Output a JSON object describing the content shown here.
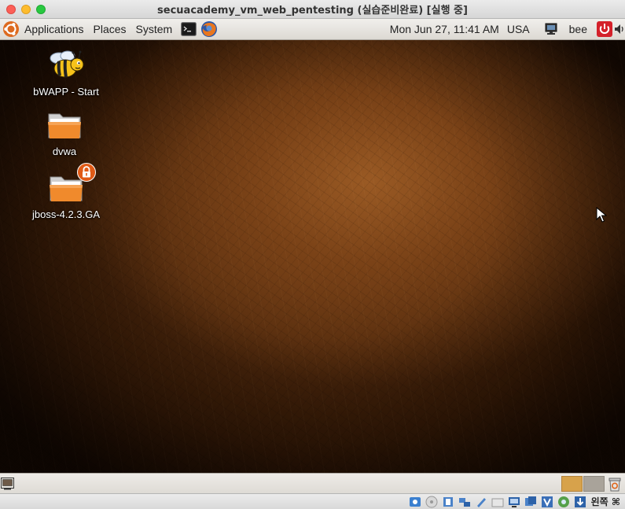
{
  "window": {
    "title": "secuacademy_vm_web_pentesting (실습준비완료) [실행 중]"
  },
  "top_panel": {
    "menus": [
      "Applications",
      "Places",
      "System"
    ],
    "clock": "Mon Jun 27, 11:41 AM",
    "keyboard_layout": "USA",
    "user": "bee",
    "launchers": [
      "terminal-icon",
      "firefox-icon"
    ]
  },
  "desktop": {
    "icons": [
      {
        "label": "bWAPP - Start",
        "icon": "bee-icon"
      },
      {
        "label": "dvwa",
        "icon": "folder-icon"
      },
      {
        "label": "jboss-4.2.3.GA",
        "icon": "folder-icon",
        "badge": "lock-icon"
      }
    ]
  },
  "bottom_panel": {
    "workspaces": 2,
    "active_workspace": 1
  },
  "vbox_status": {
    "host_key": "왼쪽 ⌘"
  },
  "colors": {
    "titlebar": "#e0e0e0",
    "panel": "#e8e5e0",
    "workspace_active": "#d7a24b",
    "desktop_accent": "#7a4217"
  }
}
